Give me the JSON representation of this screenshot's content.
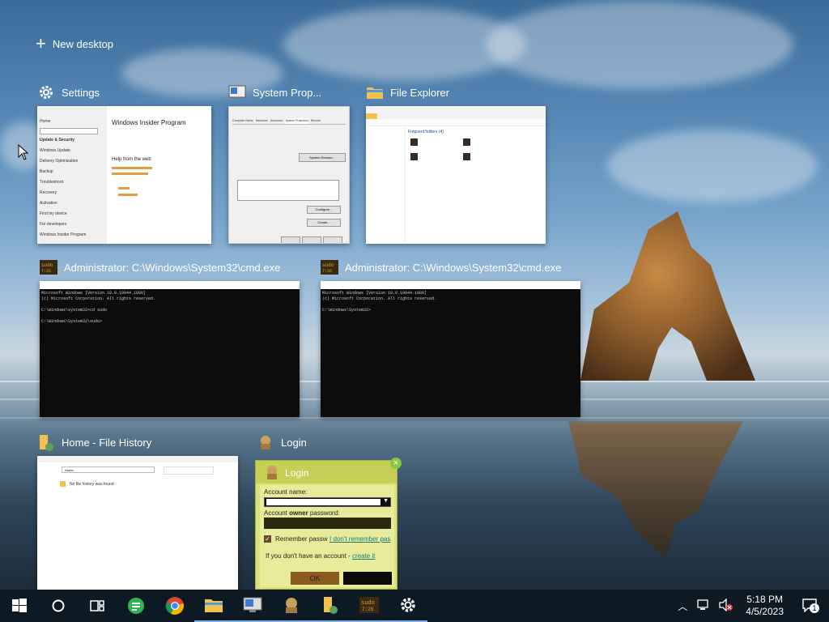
{
  "new_desktop": {
    "label": "New desktop"
  },
  "windows": [
    {
      "title": "Settings"
    },
    {
      "title": "System Prop..."
    },
    {
      "title": "File Explorer"
    },
    {
      "title": "Administrator: C:\\Windows\\System32\\cmd.exe"
    },
    {
      "title": "Administrator: C:\\Windows\\System32\\cmd.exe"
    },
    {
      "title": "Home - File History"
    },
    {
      "title": "Login"
    }
  ],
  "settings_thumb": {
    "heading": "Windows Insider Program",
    "help": "Help from the web",
    "side_items": [
      "Home",
      "Update & Security",
      "Windows Update",
      "Delivery Optimization",
      "Backup",
      "Troubleshoot",
      "Recovery",
      "Activation",
      "Find my device",
      "For developers",
      "Windows Insider Program"
    ]
  },
  "sysprop_thumb": {
    "tabs": [
      "Computer Name",
      "Hardware",
      "Advanced",
      "System Protection",
      "Remote"
    ],
    "system_restore": "System Restore...",
    "configure": "Configure...",
    "create": "Create..."
  },
  "explorer_thumb": {
    "section": "Frequent folders (4)"
  },
  "cmd1": {
    "lines": [
      "Microsoft Windows [Version 10.0.19044.1889]",
      "(c) Microsoft Corporation. All rights reserved.",
      "",
      "C:\\Windows\\system32>cd sudo",
      "",
      "C:\\Windows\\System32\\sudo>"
    ]
  },
  "cmd2": {
    "lines": [
      "Microsoft Windows [Version 10.0.19044.1889]",
      "(c) Microsoft Corporation. All rights reserved.",
      "",
      "C:\\Windows\\System32>"
    ]
  },
  "filehistory_thumb": {
    "address": "Home",
    "message": "No file history was found"
  },
  "login_win": {
    "title": "Login",
    "account_name_label": "Account name:",
    "password_label_prefix": "Account ",
    "password_label_bold": "owner",
    "password_label_suffix": " password:",
    "remember": "Remember passw",
    "forgot": "I don't remember pas",
    "no_account": "If you don't have an account - ",
    "create": "create it",
    "ok": "OK"
  },
  "taskbar": {
    "icons": [
      "start-icon",
      "cortana-icon",
      "task-view-icon",
      "app-green-icon",
      "chrome-icon",
      "file-explorer-icon",
      "system-properties-icon",
      "login-app-icon",
      "file-history-icon",
      "cmd-icon",
      "settings-icon"
    ],
    "time": "5:18 PM",
    "date": "4/5/2023",
    "notification_count": "1"
  },
  "colors": {
    "taskbar": "#0d1a24",
    "login_bg": "#d9e27a",
    "cmd_bg": "#0c0c0c"
  }
}
